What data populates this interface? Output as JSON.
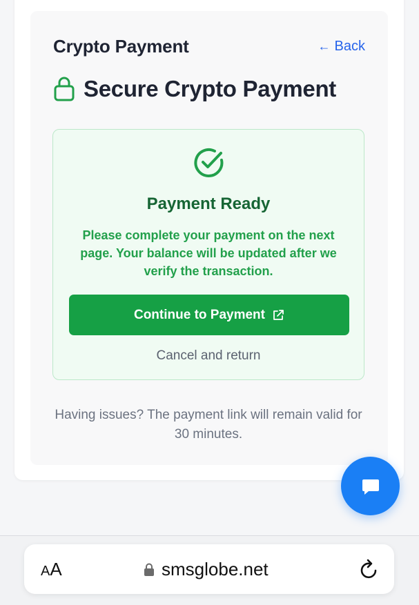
{
  "header": {
    "title": "Crypto Payment",
    "back_label": "Back"
  },
  "secure": {
    "title": "Secure Crypto Payment",
    "icon": "lock-icon"
  },
  "status": {
    "icon": "check-circle-icon",
    "title": "Payment Ready",
    "message": "Please complete your payment on the next page. Your balance will be updated after we verify the transaction."
  },
  "actions": {
    "continue_label": "Continue to Payment",
    "cancel_label": "Cancel and return"
  },
  "footer_note": "Having issues? The payment link will remain valid for 30 minutes.",
  "browser": {
    "aa_small": "A",
    "aa_large": "A",
    "url": "smsglobe.net"
  },
  "colors": {
    "accent_green": "#16a045",
    "link_blue": "#2563eb",
    "chat_blue": "#1a7ff5",
    "dark_text": "#1f2433"
  }
}
